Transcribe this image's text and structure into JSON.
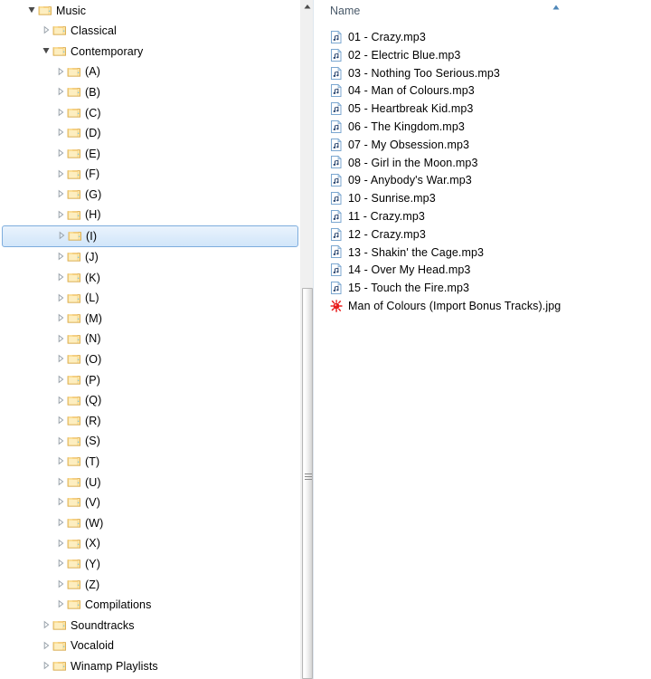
{
  "nav": {
    "scrollbar": {
      "up_arrow_icon": "chevron-up-icon",
      "thumb_grip_icon": "grip-lines-icon"
    },
    "items": [
      {
        "label": "Music",
        "level": 1,
        "state": "expanded",
        "icon": "folder-icon",
        "selected": false
      },
      {
        "label": "Classical",
        "level": 2,
        "state": "collapsed",
        "icon": "folder-icon",
        "selected": false
      },
      {
        "label": "Contemporary",
        "level": 2,
        "state": "expanded",
        "icon": "folder-icon",
        "selected": false
      },
      {
        "label": "(A)",
        "level": 3,
        "state": "collapsed",
        "icon": "folder-icon",
        "selected": false
      },
      {
        "label": "(B)",
        "level": 3,
        "state": "collapsed",
        "icon": "folder-icon",
        "selected": false
      },
      {
        "label": "(C)",
        "level": 3,
        "state": "collapsed",
        "icon": "folder-icon",
        "selected": false
      },
      {
        "label": "(D)",
        "level": 3,
        "state": "collapsed",
        "icon": "folder-icon",
        "selected": false
      },
      {
        "label": "(E)",
        "level": 3,
        "state": "collapsed",
        "icon": "folder-icon",
        "selected": false
      },
      {
        "label": "(F)",
        "level": 3,
        "state": "collapsed",
        "icon": "folder-icon",
        "selected": false
      },
      {
        "label": "(G)",
        "level": 3,
        "state": "collapsed",
        "icon": "folder-icon",
        "selected": false
      },
      {
        "label": "(H)",
        "level": 3,
        "state": "collapsed",
        "icon": "folder-icon",
        "selected": false
      },
      {
        "label": "(I)",
        "level": 3,
        "state": "collapsed",
        "icon": "folder-icon",
        "selected": true
      },
      {
        "label": "(J)",
        "level": 3,
        "state": "collapsed",
        "icon": "folder-icon",
        "selected": false
      },
      {
        "label": "(K)",
        "level": 3,
        "state": "collapsed",
        "icon": "folder-icon",
        "selected": false
      },
      {
        "label": "(L)",
        "level": 3,
        "state": "collapsed",
        "icon": "folder-icon",
        "selected": false
      },
      {
        "label": "(M)",
        "level": 3,
        "state": "collapsed",
        "icon": "folder-icon",
        "selected": false
      },
      {
        "label": "(N)",
        "level": 3,
        "state": "collapsed",
        "icon": "folder-icon",
        "selected": false
      },
      {
        "label": "(O)",
        "level": 3,
        "state": "collapsed",
        "icon": "folder-icon",
        "selected": false
      },
      {
        "label": "(P)",
        "level": 3,
        "state": "collapsed",
        "icon": "folder-icon",
        "selected": false
      },
      {
        "label": "(Q)",
        "level": 3,
        "state": "collapsed",
        "icon": "folder-icon",
        "selected": false
      },
      {
        "label": "(R)",
        "level": 3,
        "state": "collapsed",
        "icon": "folder-icon",
        "selected": false
      },
      {
        "label": "(S)",
        "level": 3,
        "state": "collapsed",
        "icon": "folder-icon",
        "selected": false
      },
      {
        "label": "(T)",
        "level": 3,
        "state": "collapsed",
        "icon": "folder-icon",
        "selected": false
      },
      {
        "label": "(U)",
        "level": 3,
        "state": "collapsed",
        "icon": "folder-icon",
        "selected": false
      },
      {
        "label": "(V)",
        "level": 3,
        "state": "collapsed",
        "icon": "folder-icon",
        "selected": false
      },
      {
        "label": "(W)",
        "level": 3,
        "state": "collapsed",
        "icon": "folder-icon",
        "selected": false
      },
      {
        "label": "(X)",
        "level": 3,
        "state": "collapsed",
        "icon": "folder-icon",
        "selected": false
      },
      {
        "label": "(Y)",
        "level": 3,
        "state": "collapsed",
        "icon": "folder-icon",
        "selected": false
      },
      {
        "label": "(Z)",
        "level": 3,
        "state": "collapsed",
        "icon": "folder-icon",
        "selected": false
      },
      {
        "label": "Compilations",
        "level": 3,
        "state": "collapsed",
        "icon": "folder-icon",
        "selected": false
      },
      {
        "label": "Soundtracks",
        "level": 2,
        "state": "collapsed",
        "icon": "folder-icon",
        "selected": false
      },
      {
        "label": "Vocaloid",
        "level": 2,
        "state": "collapsed",
        "icon": "folder-icon",
        "selected": false
      },
      {
        "label": "Winamp Playlists",
        "level": 2,
        "state": "collapsed",
        "icon": "folder-icon",
        "selected": false
      }
    ]
  },
  "list": {
    "columns": [
      {
        "label": "Name",
        "sorted": true,
        "sort_direction": "ascending",
        "sort_icon": "sort-ascending-icon"
      }
    ],
    "files": [
      {
        "name": "01 - Crazy.mp3",
        "icon": "mp3-file-icon"
      },
      {
        "name": "02 - Electric Blue.mp3",
        "icon": "mp3-file-icon"
      },
      {
        "name": "03 - Nothing Too Serious.mp3",
        "icon": "mp3-file-icon"
      },
      {
        "name": "04 - Man of Colours.mp3",
        "icon": "mp3-file-icon"
      },
      {
        "name": "05 - Heartbreak Kid.mp3",
        "icon": "mp3-file-icon"
      },
      {
        "name": "06 - The Kingdom.mp3",
        "icon": "mp3-file-icon"
      },
      {
        "name": "07 - My Obsession.mp3",
        "icon": "mp3-file-icon"
      },
      {
        "name": "08 - Girl in the Moon.mp3",
        "icon": "mp3-file-icon"
      },
      {
        "name": "09 - Anybody's War.mp3",
        "icon": "mp3-file-icon"
      },
      {
        "name": "10 - Sunrise.mp3",
        "icon": "mp3-file-icon"
      },
      {
        "name": "11 - Crazy.mp3",
        "icon": "mp3-file-icon"
      },
      {
        "name": "12 - Crazy.mp3",
        "icon": "mp3-file-icon"
      },
      {
        "name": "13 - Shakin' the Cage.mp3",
        "icon": "mp3-file-icon"
      },
      {
        "name": "14 - Over My Head.mp3",
        "icon": "mp3-file-icon"
      },
      {
        "name": "15 - Touch the Fire.mp3",
        "icon": "mp3-file-icon"
      },
      {
        "name": "Man of Colours (Import Bonus Tracks).jpg",
        "icon": "jpg-thumbnail-icon"
      }
    ]
  },
  "colors": {
    "selection_border": "#7eaddd",
    "selection_fill": "#ddecfb",
    "folder": "#ffd280",
    "header_text": "#4a5a6a",
    "sort_indicator": "#3a78b5",
    "jpg_thumb": "#e02020"
  }
}
